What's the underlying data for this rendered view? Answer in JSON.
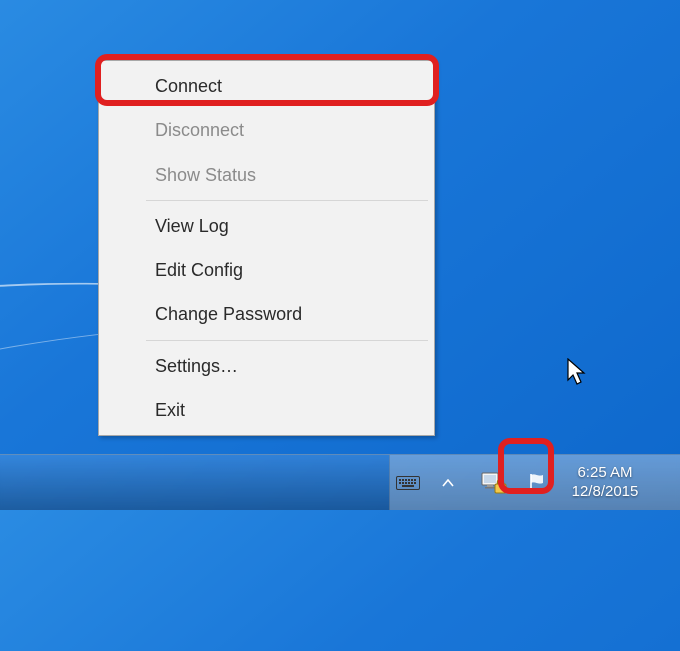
{
  "context_menu": {
    "items": [
      {
        "label": "Connect",
        "disabled": false
      },
      {
        "label": "Disconnect",
        "disabled": true
      },
      {
        "label": "Show Status",
        "disabled": true
      },
      {
        "sep": true
      },
      {
        "label": "View Log",
        "disabled": false
      },
      {
        "label": "Edit Config",
        "disabled": false
      },
      {
        "label": "Change Password",
        "disabled": false
      },
      {
        "sep": true
      },
      {
        "label": "Settings…",
        "disabled": false
      },
      {
        "label": "Exit",
        "disabled": false
      }
    ]
  },
  "taskbar": {
    "time": "6:25 AM",
    "date": "12/8/2015"
  },
  "highlights": {
    "connect_item": true,
    "vpn_tray_icon": true
  }
}
